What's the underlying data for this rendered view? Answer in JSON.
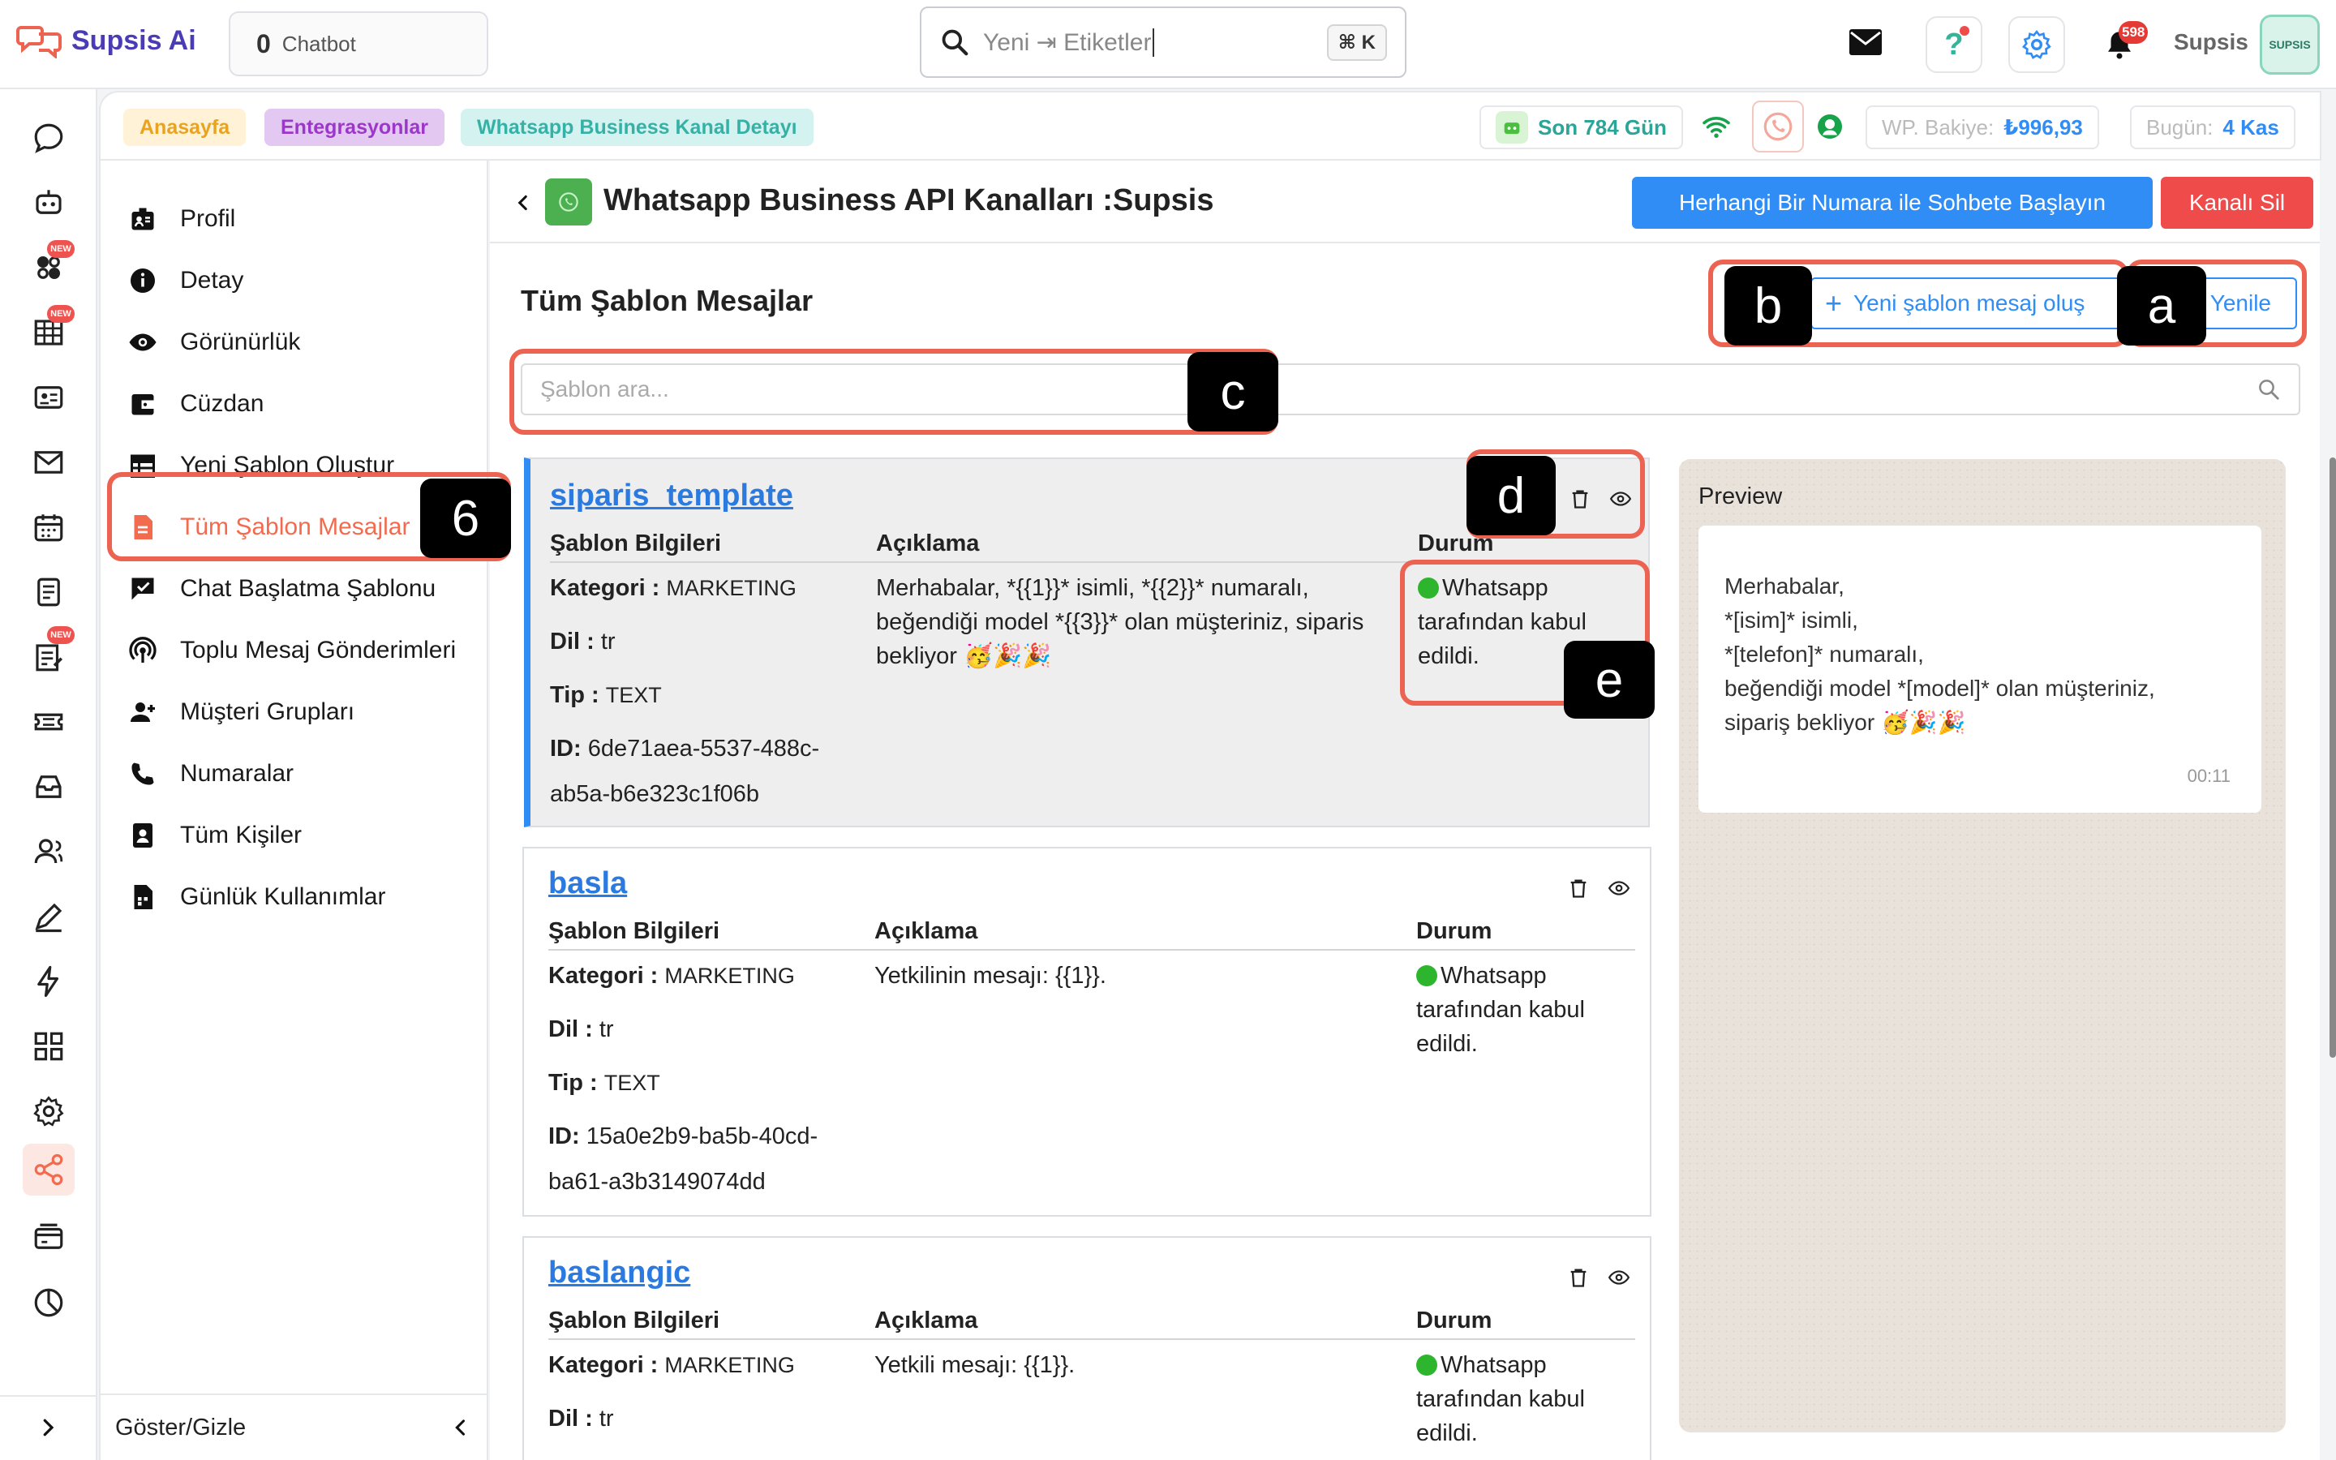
{
  "app": {
    "logo_text": "Supsis Ai",
    "chatbot_count": "0",
    "chatbot_label": "Chatbot"
  },
  "search": {
    "text": "Yeni ⇥ Etiketler",
    "shortcut": "⌘ K"
  },
  "topbar": {
    "notification_count": "598",
    "user_name": "Supsis",
    "avatar_text": "SUPSIS"
  },
  "breadcrumb": [
    "Anasayfa",
    "Entegrasyonlar",
    "Whatsapp Business Kanal Detayı"
  ],
  "status": {
    "days": "Son 784 Gün",
    "balance_label": "WP. Bakiye:",
    "balance_value": "₺996,93",
    "today_label": "Bugün:",
    "today_value": "4 Kas"
  },
  "sidebar": {
    "items": [
      {
        "label": "Profil",
        "icon": "profile-icon"
      },
      {
        "label": "Detay",
        "icon": "info-icon"
      },
      {
        "label": "Görünürlük",
        "icon": "eye-icon"
      },
      {
        "label": "Cüzdan",
        "icon": "wallet-icon"
      },
      {
        "label": "Yeni Şablon Oluştur",
        "icon": "table-icon"
      },
      {
        "label": "Tüm Şablon Mesajlar",
        "icon": "document-icon",
        "active": true
      },
      {
        "label": "Chat Başlatma Şablonu",
        "icon": "chat-check-icon"
      },
      {
        "label": "Toplu Mesaj Gönderimleri",
        "icon": "broadcast-icon"
      },
      {
        "label": "Müşteri Grupları",
        "icon": "group-add-icon"
      },
      {
        "label": "Numaralar",
        "icon": "phone-icon"
      },
      {
        "label": "Tüm Kişiler",
        "icon": "contacts-icon"
      },
      {
        "label": "Günlük Kullanımlar",
        "icon": "daily-usage-icon"
      }
    ],
    "footer": "Göster/Gizle"
  },
  "header": {
    "title": "Whatsapp Business API Kanalları :Supsis",
    "start_chat": "Herhangi Bir Numara ile Sohbete Başlayın",
    "delete_channel": "Kanalı Sil"
  },
  "section": {
    "title": "Tüm Şablon Mesajlar",
    "new_template": "Yeni şablon mesaj oluş",
    "refresh": "Yenile",
    "search_placeholder": "Şablon ara..."
  },
  "columns": {
    "info": "Şablon Bilgileri",
    "desc": "Açıklama",
    "status": "Durum"
  },
  "field_labels": {
    "category": "Kategori :",
    "lang": "Dil :",
    "type": "Tip :",
    "id": "ID:"
  },
  "templates": [
    {
      "name": "siparis_template",
      "category": "MARKETING",
      "lang": "tr",
      "type": "TEXT",
      "id_1": "6de71aea-5537-488c-",
      "id_2": "ab5a-b6e323c1f06b",
      "desc_1": "Merhabalar, *{{1}}* isimli, *{{2}}* numaralı,",
      "desc_2": "beğendiği model *{{3}}* olan müşteriniz, siparis",
      "desc_3": "bekliyor 🥳🎉🎉",
      "status_1": "Whatsapp",
      "status_2": "tarafından kabul",
      "status_3": "edildi."
    },
    {
      "name": "basla",
      "category": "MARKETING",
      "lang": "tr",
      "type": "TEXT",
      "id_1": "15a0e2b9-ba5b-40cd-",
      "id_2": "ba61-a3b3149074dd",
      "desc_1": "Yetkilinin mesajı: {{1}}.",
      "status_1": "Whatsapp",
      "status_2": "tarafından kabul",
      "status_3": "edildi."
    },
    {
      "name": "baslangic",
      "category": "MARKETING",
      "lang": "tr",
      "desc_1": "Yetkili mesajı: {{1}}.",
      "status_1": "Whatsapp",
      "status_2": "tarafından kabul",
      "status_3": "edildi."
    }
  ],
  "preview": {
    "title": "Preview",
    "lines": [
      "Merhabalar,",
      "*[isim]* isimli,",
      "*[telefon]* numaralı,",
      "beğendiği model *[model]* olan müşteriniz,",
      "sipariş bekliyor 🥳🎉🎉"
    ],
    "time": "00:11"
  },
  "annotations": {
    "a": "a",
    "b": "b",
    "c": "c",
    "d": "d",
    "e": "e",
    "six": "6"
  },
  "colors": {
    "accent": "#2f8df5",
    "danger": "#ef4b4b",
    "active": "#f26b4f",
    "highlight": "#ec6351",
    "approved": "#2eb52e"
  }
}
